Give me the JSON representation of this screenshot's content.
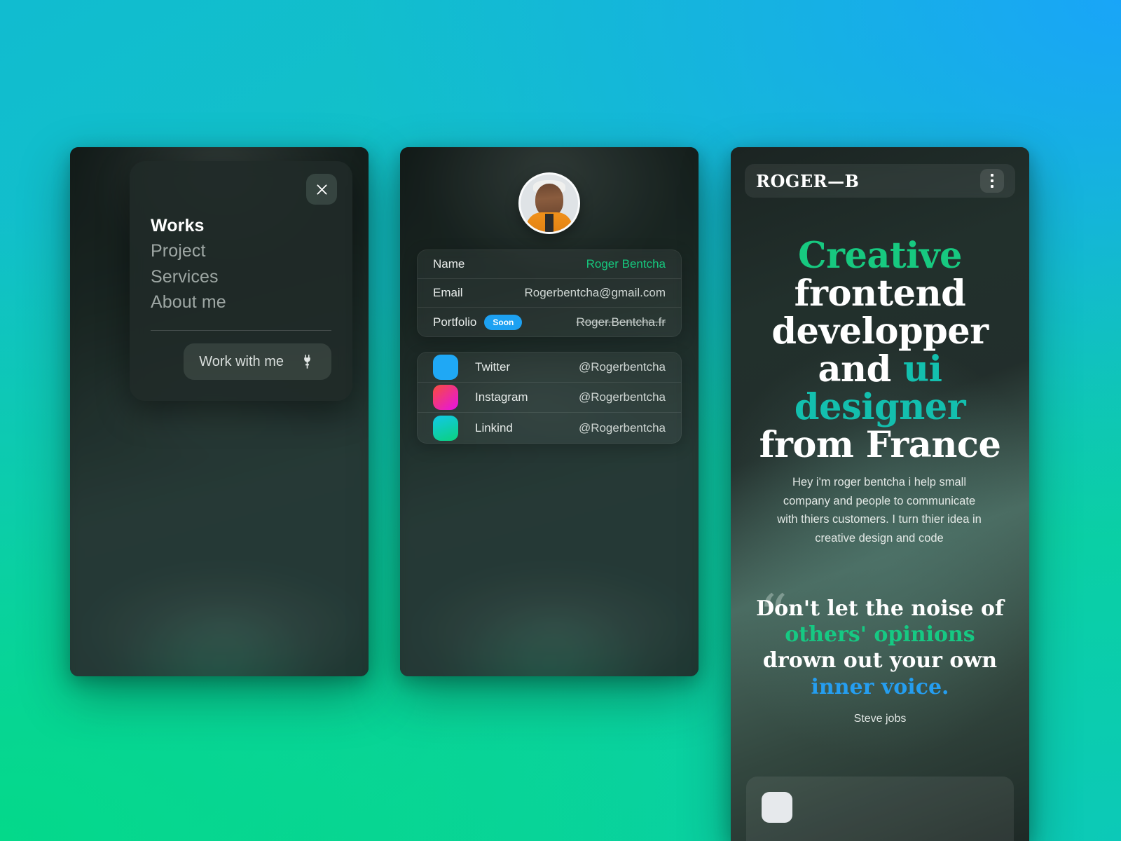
{
  "background": {
    "colors": {
      "cyan": "#11BCD0",
      "blue": "#19A5F8",
      "green": "#04D98A",
      "teal": "#0CC9B8"
    }
  },
  "phone_1": {
    "name": "menu-screen",
    "menu_sheet": {
      "close_icon": "close-icon",
      "items": [
        {
          "label": "Works",
          "active": true
        },
        {
          "label": "Project",
          "active": false
        },
        {
          "label": "Services",
          "active": false
        },
        {
          "label": "About me",
          "active": false
        }
      ],
      "cta": {
        "label": "Work with me",
        "icon": "power-plug-icon"
      }
    }
  },
  "phone_2": {
    "name": "profile-screen",
    "avatar": "profile-avatar",
    "info_rows": [
      {
        "key": "Name",
        "value": "Roger Bentcha",
        "style": "accent",
        "badge": ""
      },
      {
        "key": "Email",
        "value": "Rogerbentcha@gmail.com",
        "style": "normal",
        "badge": ""
      },
      {
        "key": "Portfolio",
        "value": "Roger.Bentcha.fr",
        "style": "struck",
        "badge": "Soon"
      }
    ],
    "social_rows": [
      {
        "name": "Twitter",
        "handle": "@Rogerbentcha",
        "icon": "twitter-icon",
        "color_a": "#1FA8F5",
        "color_b": "#1C9DF0"
      },
      {
        "name": "Instagram",
        "handle": "@Rogerbentcha",
        "icon": "instagram-icon",
        "color_a": "#F74D3C",
        "color_b": "#E612E6"
      },
      {
        "name": "Linkind",
        "handle": "@Rogerbentcha",
        "icon": "linkedin-icon",
        "color_a": "#12C8E8",
        "color_b": "#0BD17E"
      }
    ]
  },
  "phone_3": {
    "name": "landing-screen",
    "top_bar": {
      "brand": "ROGER—B",
      "menu_icon": "kebab-menu-icon"
    },
    "hero": {
      "line_1": "Creative",
      "line_2": "frontend",
      "line_3": "developper",
      "line_4_a": "and ",
      "line_4_b": "ui designer",
      "line_5": "from France",
      "accent_green": "#17C980",
      "accent_teal": "#13BFAE"
    },
    "intro": "Hey i'm roger bentcha i help small company and people to communicate with thiers customers. I turn thier idea in creative design and code",
    "quote": {
      "mark": "“",
      "part_1": "Don't let the noise of ",
      "part_2": "others' opinions",
      "part_3": " drown out your own ",
      "part_4": "inner voice.",
      "author": "Steve jobs",
      "accent_green": "#16C983",
      "accent_blue": "#259EF0"
    }
  }
}
